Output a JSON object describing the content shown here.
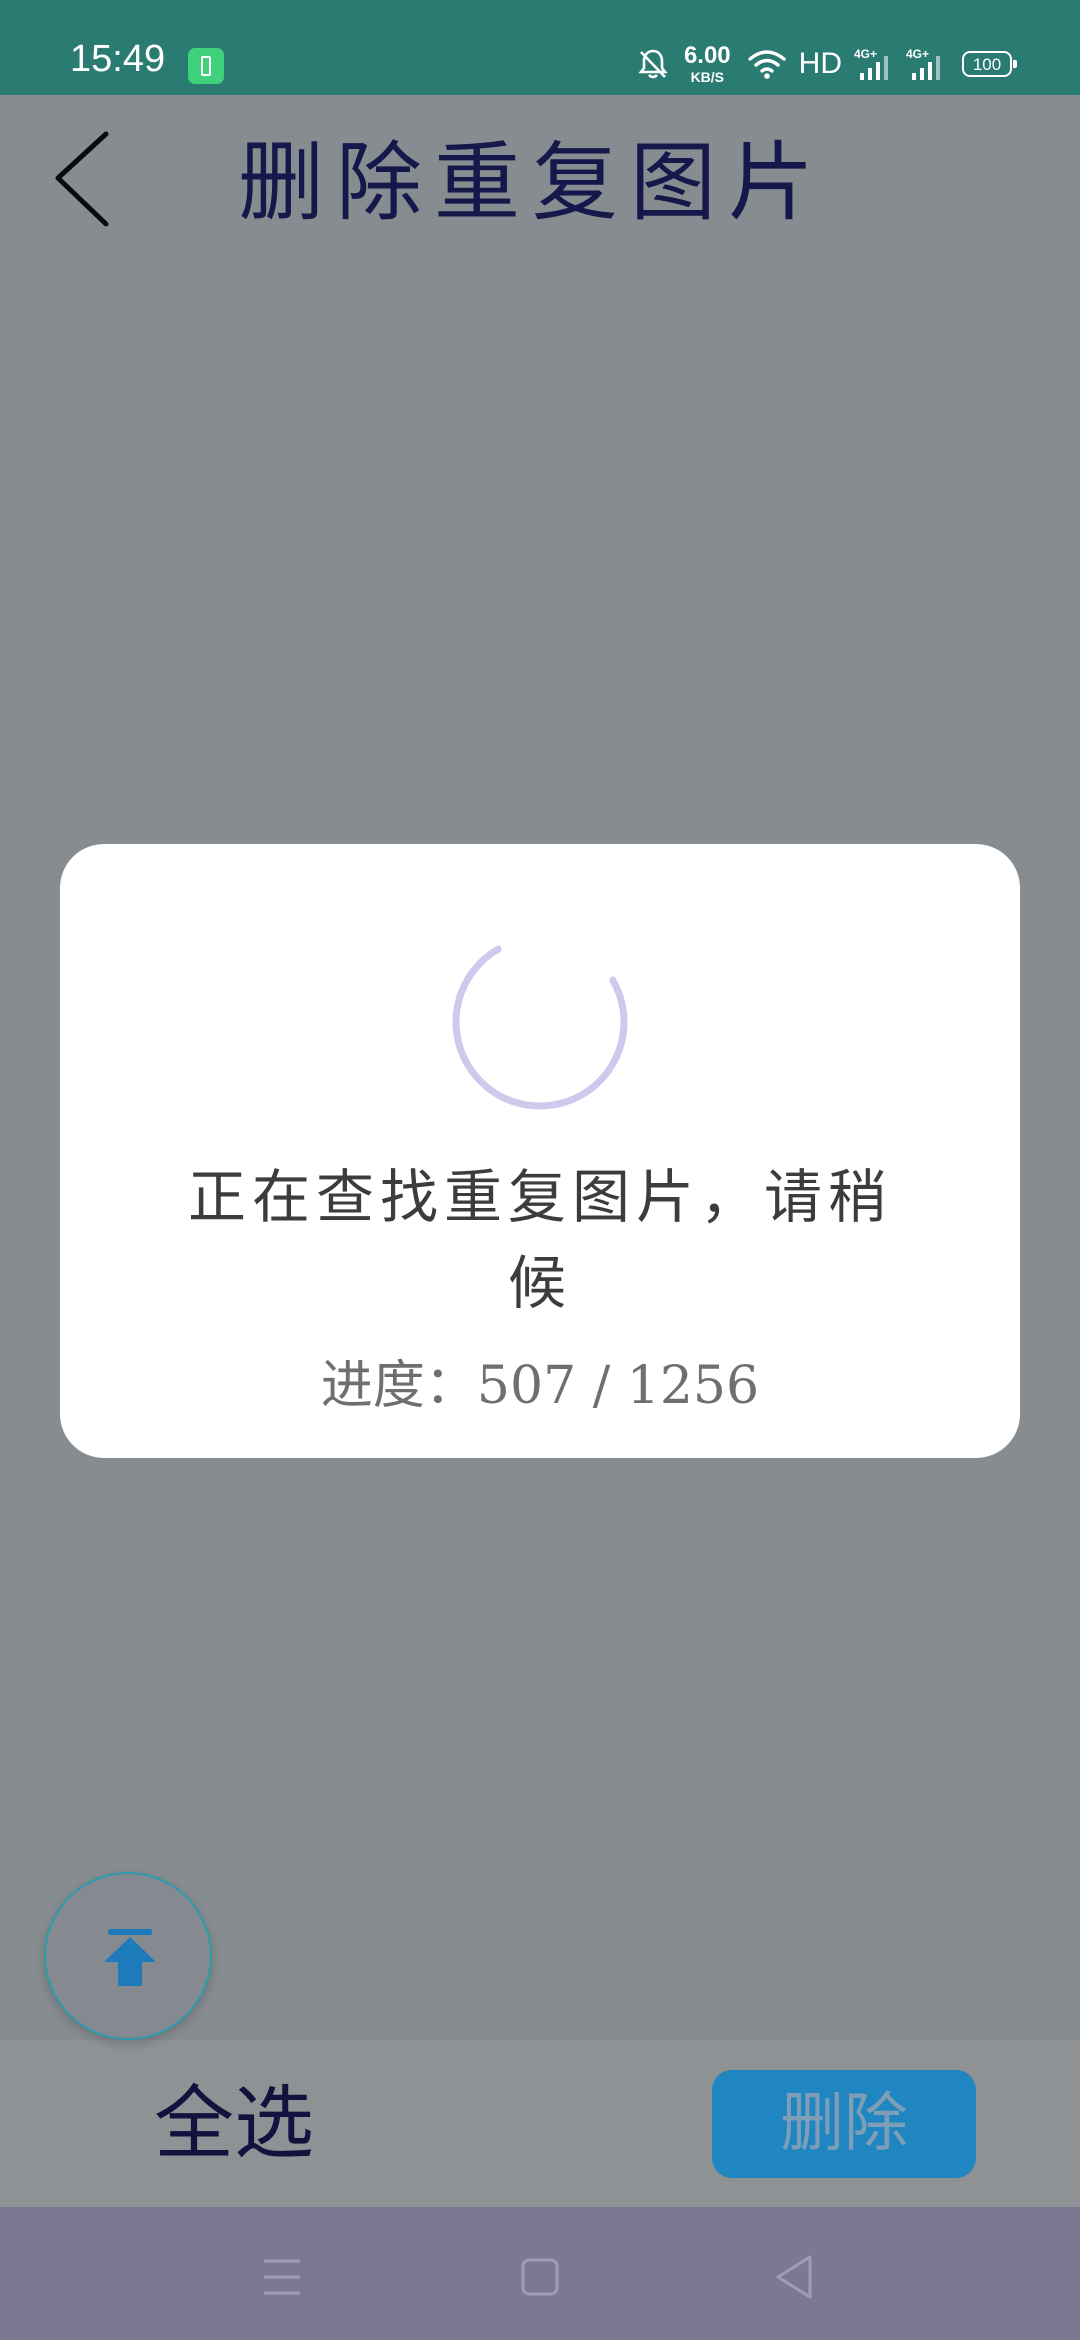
{
  "status_bar": {
    "time": "15:49",
    "net_speed_value": "6.00",
    "net_speed_unit": "KB/S",
    "hd_label": "HD",
    "signal_1_label": "4G+",
    "signal_2_label": "4G+",
    "battery_level": "100"
  },
  "header": {
    "title": "删除重复图片"
  },
  "dialog": {
    "message": "正在查找重复图片，请稍候",
    "progress_text": "进度：507 / 1256",
    "progress_done": 507,
    "progress_total": 1256
  },
  "bottom_bar": {
    "select_all_label": "全选",
    "delete_label": "删除"
  },
  "icons": {
    "back": "back-arrow-icon",
    "scroll_top": "scroll-to-top-icon",
    "spinner": "loading-spinner-icon",
    "nav_menu": "menu-icon",
    "nav_home": "home-icon",
    "nav_back": "nav-back-icon"
  },
  "colors": {
    "status_bar_bg": "#2a7b72",
    "overlay_bg": "#878c90",
    "title_color": "#14184a",
    "delete_button_bg": "#1f86c2",
    "spinner_color": "#cfc9ee",
    "nav_bar_bg": "#7b7893"
  }
}
